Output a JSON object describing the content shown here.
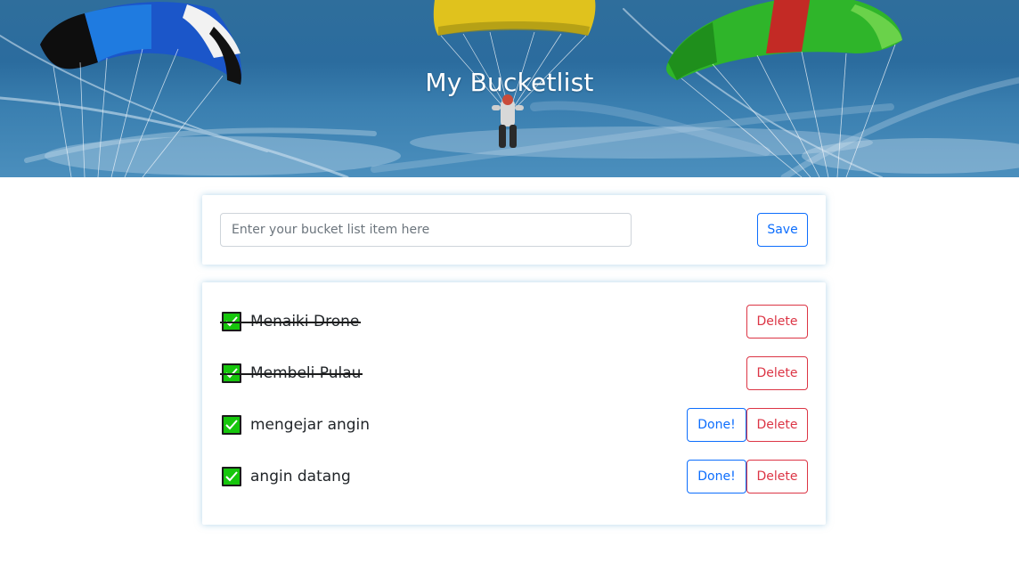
{
  "header": {
    "title": "My Bucketlist"
  },
  "form": {
    "placeholder": "Enter your bucket list item here",
    "value": "",
    "save_label": "Save"
  },
  "items": [
    {
      "text": "Menaiki Drone",
      "done": true,
      "done_label": "",
      "delete_label": "Delete"
    },
    {
      "text": "Membeli Pulau",
      "done": true,
      "done_label": "",
      "delete_label": "Delete"
    },
    {
      "text": "mengejar angin",
      "done": false,
      "done_label": "Done!",
      "delete_label": "Delete"
    },
    {
      "text": "angin datang",
      "done": false,
      "done_label": "Done!",
      "delete_label": "Delete"
    }
  ],
  "colors": {
    "primary": "#0d6efd",
    "danger": "#dc3545",
    "check_green": "#16c60c",
    "card_glow": "#78b4d7"
  },
  "icons": {
    "checkbox": "check-mark-icon"
  }
}
